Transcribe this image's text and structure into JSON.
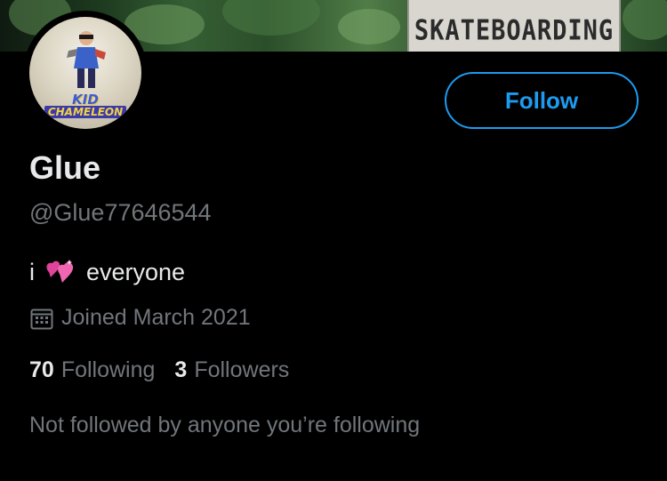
{
  "banner": {
    "sign_text": "SKATEBOARDING"
  },
  "profile": {
    "display_name": "Glue",
    "handle": "@Glue77646544",
    "bio_before": "i",
    "bio_emoji": "two-hearts-emoji",
    "bio_after": "everyone",
    "joined": "Joined March 2021",
    "following_count": "70",
    "following_label": "Following",
    "followers_count": "3",
    "followers_label": "Followers",
    "mutuals_text": "Not followed by anyone you’re following"
  },
  "avatar": {
    "logo_line1": "KID",
    "logo_line2": "CHAMELEON"
  },
  "actions": {
    "follow_label": "Follow"
  },
  "colors": {
    "accent": "#1d9bf0",
    "secondary_text": "#71767b",
    "primary_text": "#e7e9ea",
    "background": "#000000"
  }
}
